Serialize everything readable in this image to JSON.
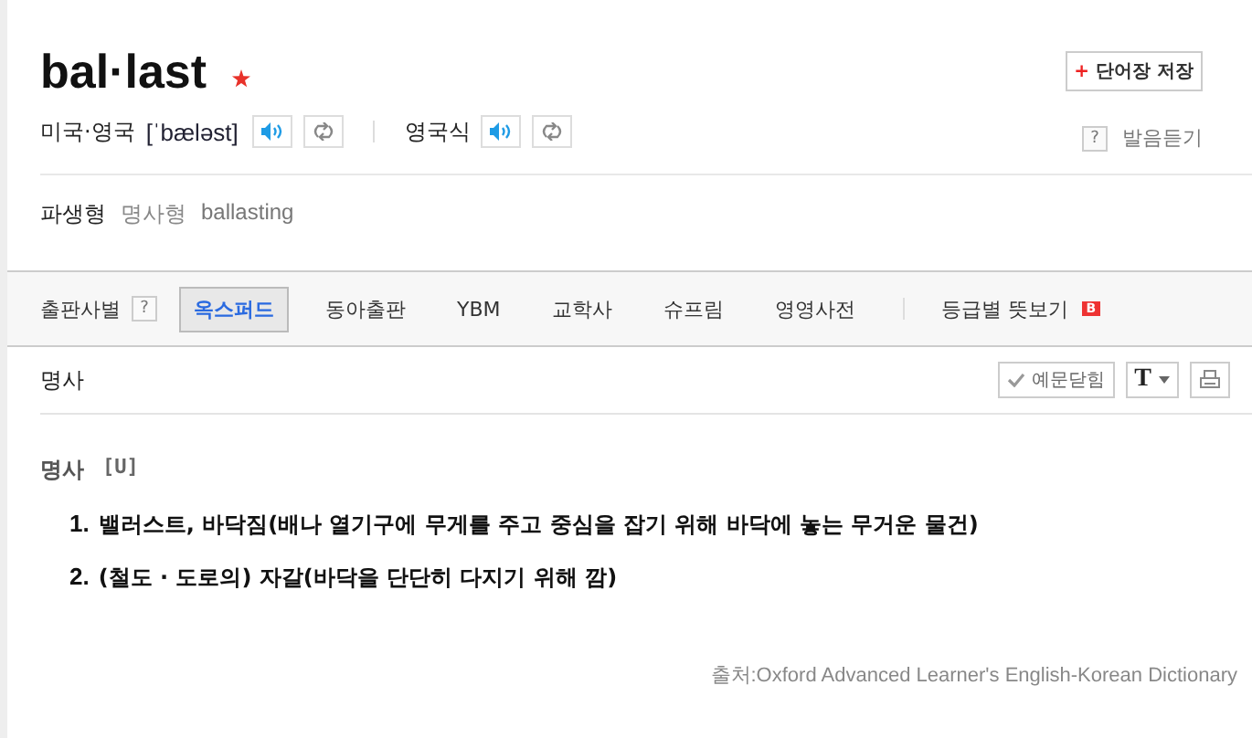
{
  "headword": {
    "text": "bal·last",
    "starred": true
  },
  "save_button": {
    "plus": "+",
    "label": "단어장 저장"
  },
  "pronunciations": [
    {
      "label": "미국·영국",
      "ipa": "[ˈbæləst]"
    },
    {
      "label": "영국식"
    }
  ],
  "listen": {
    "help": "?",
    "label": "발음듣기"
  },
  "derivation": {
    "label": "파생형",
    "pos": "명사형",
    "word": "ballasting"
  },
  "publisher_label": "출판사별",
  "publisher_help": "?",
  "tabs": [
    {
      "label": "옥스퍼드",
      "selected": true
    },
    {
      "label": "동아출판",
      "selected": false
    },
    {
      "label": "YBM",
      "selected": false
    },
    {
      "label": "교학사",
      "selected": false
    },
    {
      "label": "슈프림",
      "selected": false
    },
    {
      "label": "영영사전",
      "selected": false
    }
  ],
  "level_tab": {
    "label": "등급별 뜻보기",
    "badge": "B"
  },
  "toolbar": {
    "pos": "명사",
    "hide_examples": "예문닫힘",
    "font": "T"
  },
  "entry": {
    "pos": "명사",
    "grammar": "[U]",
    "senses": [
      {
        "number": "1.",
        "text": "밸러스트, 바닥짐(배나 열기구에 무게를 주고 중심을 잡기 위해 바닥에 놓는 무거운 물건)"
      },
      {
        "number": "2.",
        "text": "(철도 · 도로의) 자갈(바닥을 단단히 다지기 위해 깜)"
      }
    ]
  },
  "source": "출처:Oxford Advanced Learner's English-Korean Dictionary"
}
